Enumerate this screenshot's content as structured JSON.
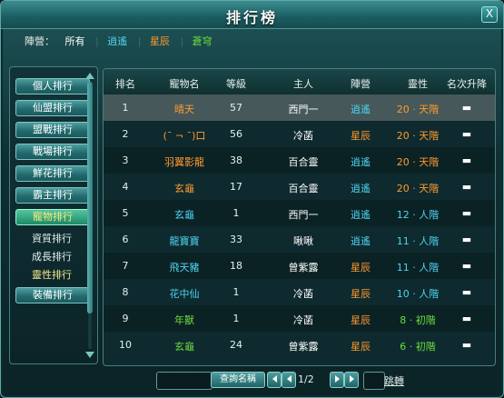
{
  "window": {
    "title": "排行榜",
    "close_label": "X"
  },
  "filters": {
    "label": "陣營：",
    "all": "所有",
    "items": [
      "逍遙",
      "星辰",
      "蒼穹"
    ]
  },
  "sidebar": {
    "buttons": [
      "個人排行",
      "仙盟排行",
      "盟戰排行",
      "戰場排行",
      "鮮花排行",
      "霸主排行",
      "寵物排行"
    ],
    "sub_items": [
      "資質排行",
      "成長排行",
      "靈性排行"
    ],
    "bottom_button": "裝備排行"
  },
  "table": {
    "headers": [
      "排名",
      "寵物名",
      "等級",
      "主人",
      "陣營",
      "靈性",
      "名次升降"
    ],
    "rows": [
      {
        "rank": "1",
        "name": "晴天",
        "level": "57",
        "owner": "西門一",
        "camp": "逍遙",
        "spirit": "20 · 天階",
        "trend": "▬"
      },
      {
        "rank": "2",
        "name": "(¯ ¬ ¯)口",
        "level": "56",
        "owner": "冷菡",
        "camp": "星辰",
        "spirit": "20 · 天階",
        "trend": "▬"
      },
      {
        "rank": "3",
        "name": "羽翼影龍",
        "level": "38",
        "owner": "百合靈",
        "camp": "逍遙",
        "spirit": "20 · 天階",
        "trend": "▬"
      },
      {
        "rank": "4",
        "name": "玄龜",
        "level": "17",
        "owner": "百合靈",
        "camp": "逍遙",
        "spirit": "20 · 天階",
        "trend": "▬"
      },
      {
        "rank": "5",
        "name": "玄龜",
        "level": "1",
        "owner": "西門一",
        "camp": "逍遙",
        "spirit": "12 · 人階",
        "trend": "▬"
      },
      {
        "rank": "6",
        "name": "龍寶寶",
        "level": "33",
        "owner": "啾啾",
        "camp": "逍遙",
        "spirit": "11 · 人階",
        "trend": "▬"
      },
      {
        "rank": "7",
        "name": "飛天豬",
        "level": "18",
        "owner": "曾紫露",
        "camp": "星辰",
        "spirit": "11 · 人階",
        "trend": "▬"
      },
      {
        "rank": "8",
        "name": "花中仙",
        "level": "1",
        "owner": "冷菡",
        "camp": "星辰",
        "spirit": "10 · 人階",
        "trend": "▬"
      },
      {
        "rank": "9",
        "name": "年獸",
        "level": "1",
        "owner": "冷菡",
        "camp": "星辰",
        "spirit": "8 · 初階",
        "trend": "▬"
      },
      {
        "rank": "10",
        "name": "玄龜",
        "level": "24",
        "owner": "曾紫露",
        "camp": "星辰",
        "spirit": "6 · 初階",
        "trend": "▬"
      }
    ]
  },
  "footer": {
    "search_placeholder": "",
    "query_button": "查詢名稱",
    "page_text": "1/2",
    "jump_input": "",
    "jump_label": "跳轉"
  },
  "colors": {
    "name_orange": "#ff9a2f",
    "name_cyan": "#4ed3f0",
    "name_green": "#6ddc3e",
    "camp_xiaoyao": "#4ed3f0",
    "camp_xingchen": "#ff9a2f"
  }
}
